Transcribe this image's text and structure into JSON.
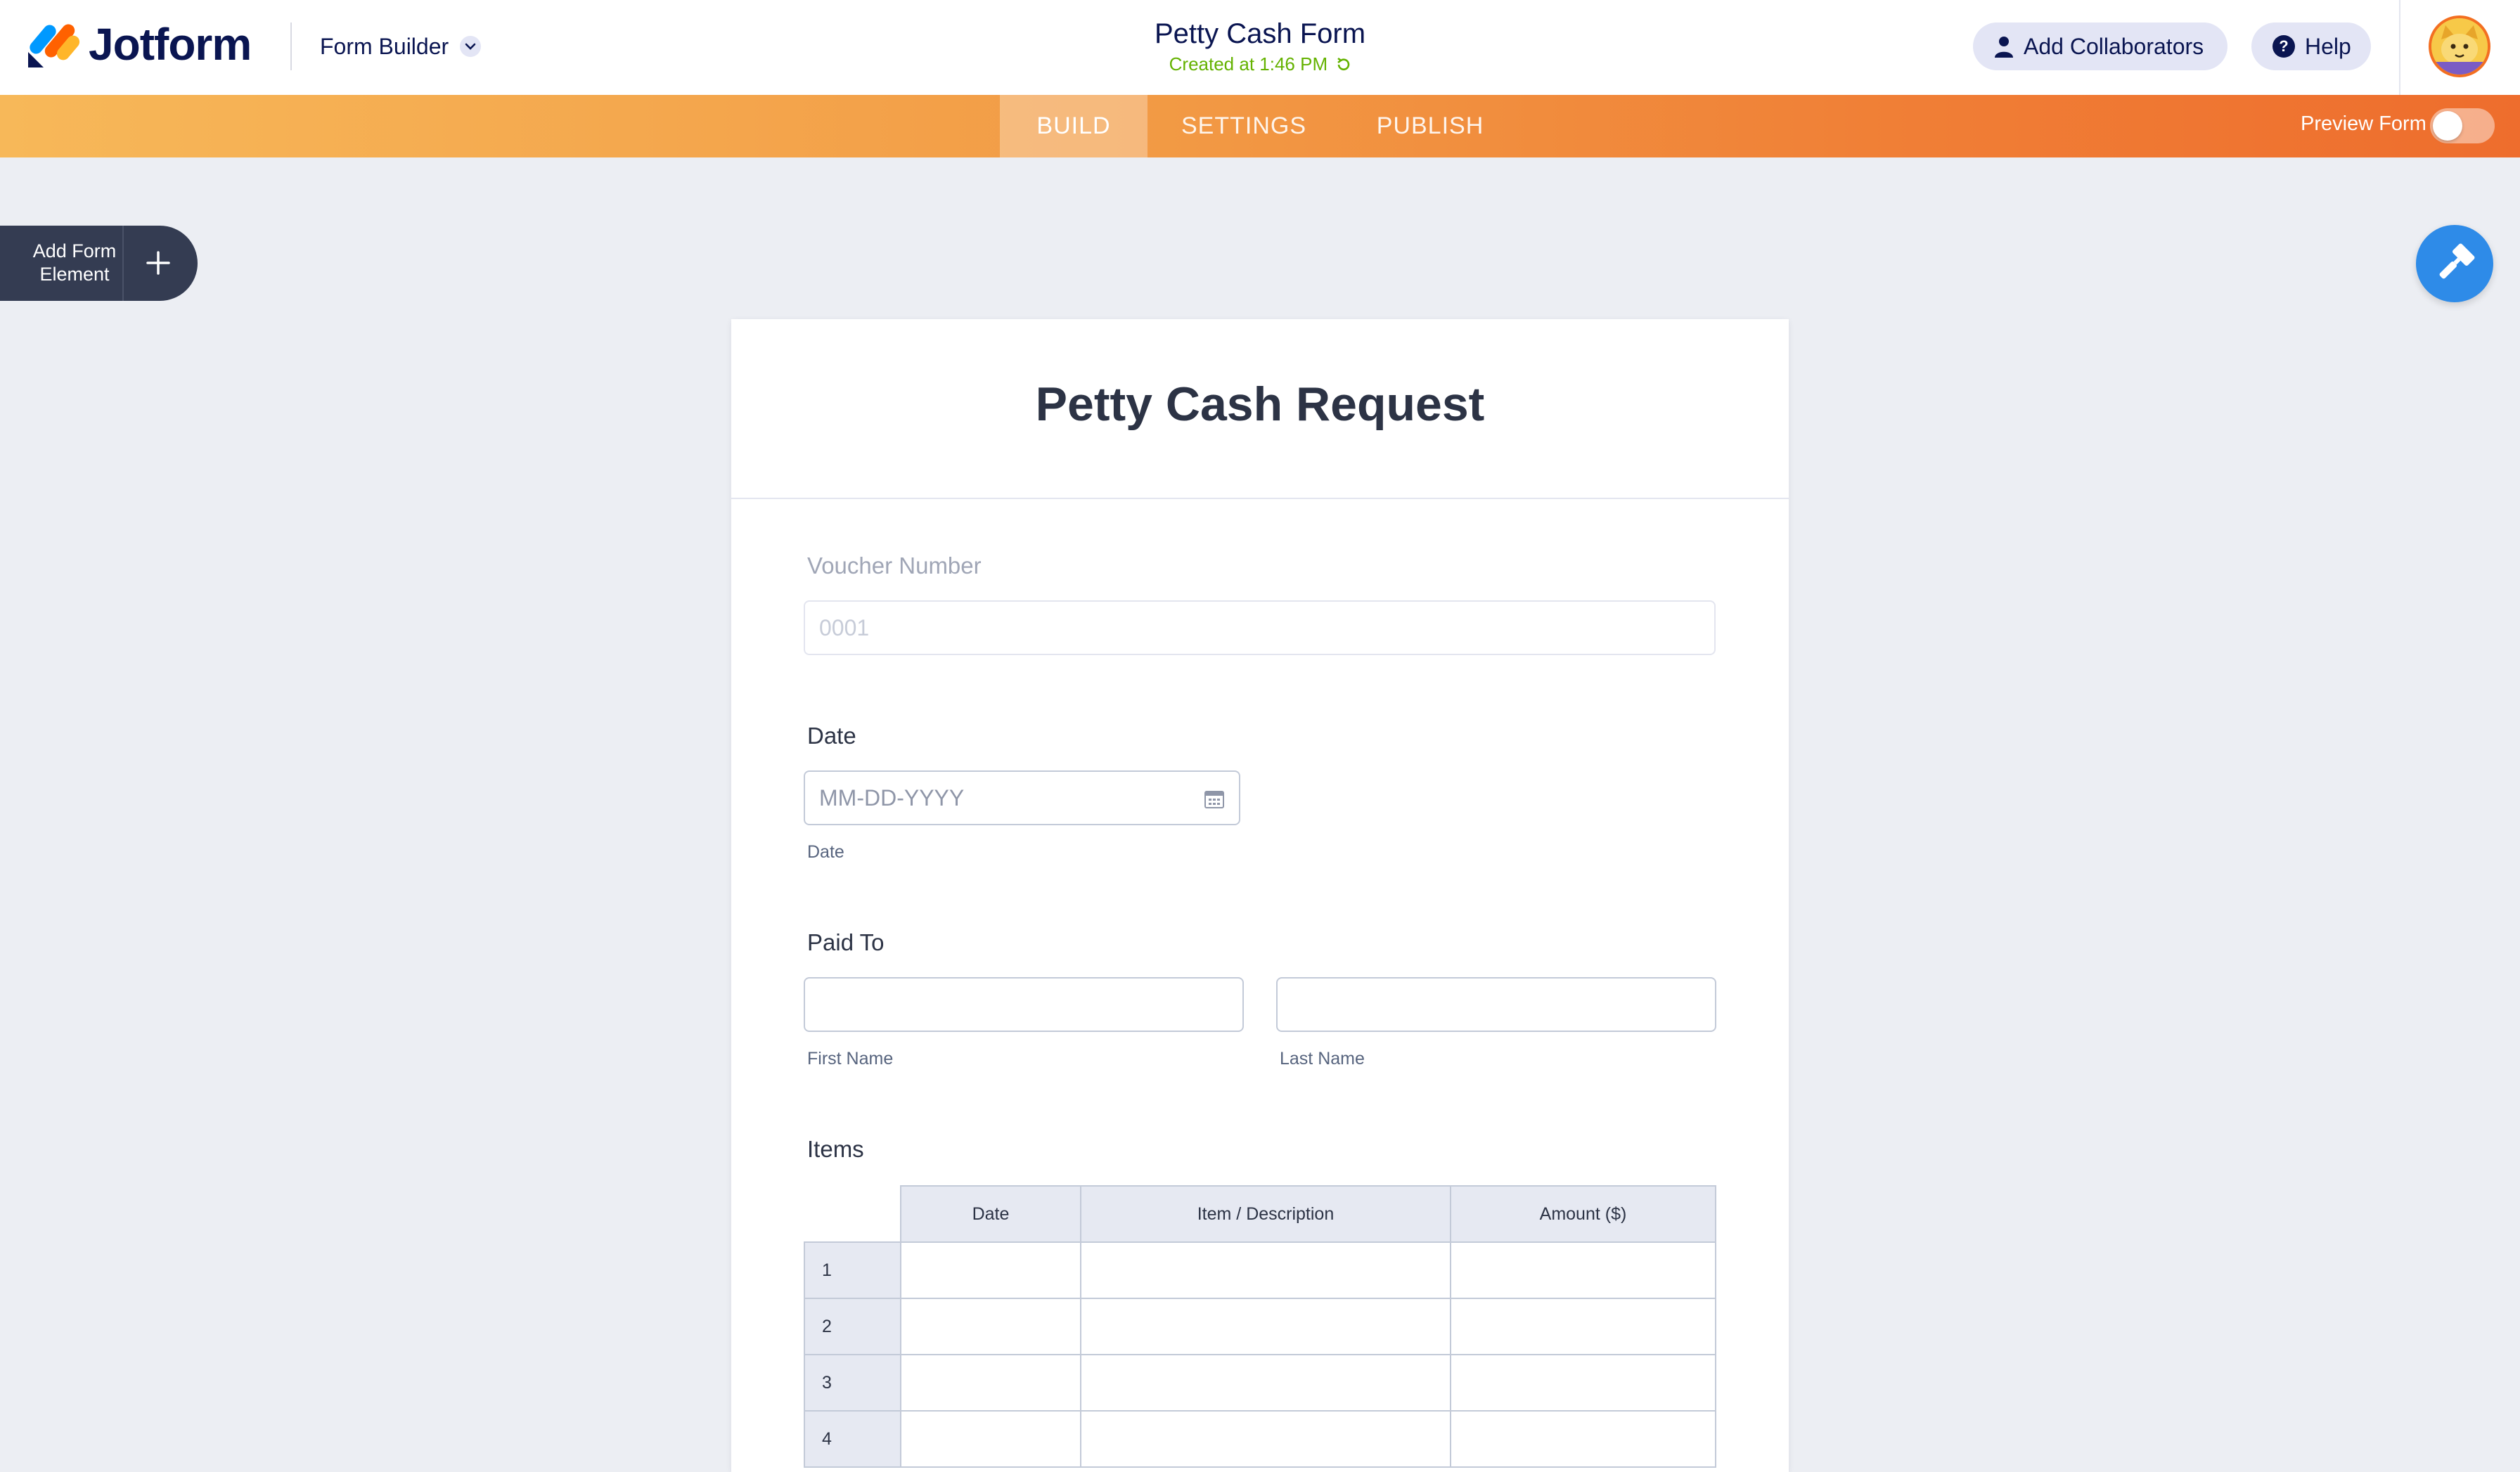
{
  "header": {
    "brand": "Jotform",
    "builder_menu": "Form Builder",
    "form_title": "Petty Cash Form",
    "created": "Created at 1:46 PM",
    "collaborators_label": "Add Collaborators",
    "help_label": "Help"
  },
  "nav": {
    "tabs": [
      {
        "label": "BUILD",
        "active": true
      },
      {
        "label": "SETTINGS",
        "active": false
      },
      {
        "label": "PUBLISH",
        "active": false
      }
    ],
    "preview_label": "Preview Form",
    "preview_on": false
  },
  "sidebar": {
    "add_element_line1": "Add Form",
    "add_element_line2": "Element"
  },
  "form": {
    "title": "Petty Cash Request",
    "voucher": {
      "label": "Voucher Number",
      "placeholder": "0001"
    },
    "date": {
      "label": "Date",
      "placeholder": "MM-DD-YYYY",
      "sublabel": "Date"
    },
    "paid_to": {
      "label": "Paid To",
      "first_sublabel": "First Name",
      "last_sublabel": "Last Name"
    },
    "items": {
      "label": "Items",
      "columns": [
        "Date",
        "Item / Description",
        "Amount ($)"
      ],
      "rows": [
        "1",
        "2",
        "3",
        "4"
      ]
    }
  },
  "colors": {
    "accent_orange": "#f07f36",
    "brand_navy": "#0a1551",
    "created_green": "#64b200",
    "paint_blue": "#2e8be8"
  }
}
